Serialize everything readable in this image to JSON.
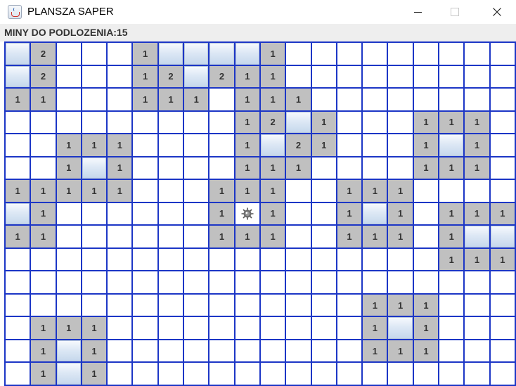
{
  "window": {
    "title": "PLANSZA SAPER",
    "icon": "java-cup-icon"
  },
  "controls": {
    "minimize": "minimize-icon",
    "maximize": "maximize-icon",
    "close": "close-icon"
  },
  "status": {
    "text": "MINY DO PODLOZENIA:15"
  },
  "board": {
    "cols": 20,
    "rows_count": 15,
    "legend": {
      "h": "hidden",
      "o": "empty-revealed",
      "1-8": "number",
      "m": "mine"
    },
    "rows": [
      "h2...1hhhh1.........",
      "h2...12h211.........",
      "11...111.111........",
      ".........12h1...111.",
      "..111....1h21...1h1.",
      "..1h1....111....111.",
      "11111...111..111....",
      "h1......1m1..1h1.111",
      "11......111..111.1hh",
      ".................111",
      "....................",
      "..............111...",
      ".111..........1h1...",
      ".1h1..........111...",
      ".1h1................"
    ]
  }
}
